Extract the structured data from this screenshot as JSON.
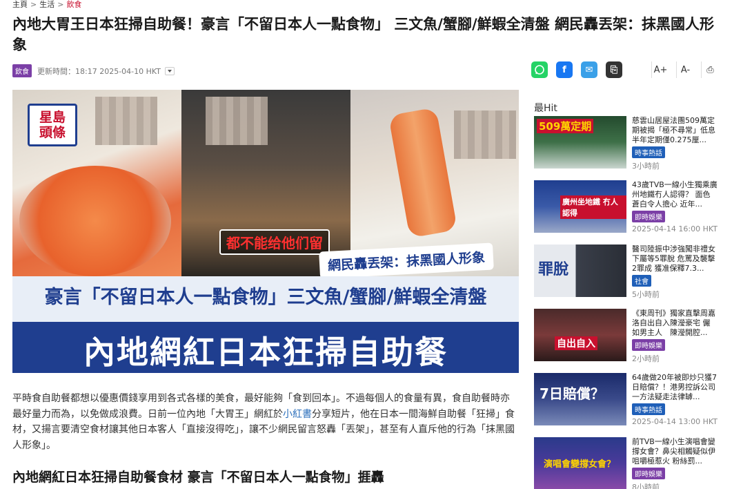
{
  "breadcrumb": {
    "home": "主頁",
    "level1": "生活",
    "current": "飲食"
  },
  "article": {
    "title": "內地大胃王日本狂掃自助餐！豪言「不留日本人一點食物」 三文魚/蟹腳/鮮蝦全清盤 網民轟丟架：抹黑國人形象",
    "category": "飲食",
    "updated": "更新時間：18:17 2025-04-10 HKT",
    "hero": {
      "logo_line1": "星島",
      "logo_line2": "頭條",
      "caption_red": "都不能给他们留",
      "netizen": "網民轟丟架：抹黑國人形象",
      "line1": "豪言「不留日本人一點食物」三文魚/蟹腳/鮮蝦全清盤",
      "line2": "內地網紅日本狂掃自助餐"
    },
    "body_part1": "平時食自助餐都想以優惠價錢享用到各式各樣的美食，最好能夠「食到回本」。不過每個人的食量有異，食自助餐時亦最好量力而為，以免做成浪費。日前一位內地「大胃王」網紅於",
    "body_link": "小紅書",
    "body_part2": "分享短片，他在日本一間海鮮自助餐「狂掃」食材，又揚言要清空食材讓其他日本客人「直接沒得吃」，讓不少網民留言怒轟「丟架」，甚至有人直斥他的行為「抹黑國人形象」。",
    "subhead": "內地網紅日本狂掃自助餐食材 豪言「不留日本人一點食物」捱轟"
  },
  "share": {
    "whatsapp": "WhatsApp",
    "facebook": "f",
    "email": "✉",
    "copy": "⎘"
  },
  "tools": {
    "font_up": "A+",
    "font_down": "A-",
    "print": "⎙"
  },
  "sidebar": {
    "heading": "最Hit",
    "items": [
      {
        "text": "慈雲山居屋法團509萬定期被揭「極不尋常」低息 半年定期僅0.275厘...",
        "badge": "時事熱話",
        "badge_color": "blue",
        "time": "3小時前",
        "thumb_text": "509萬定期"
      },
      {
        "text": "43歲TVB一線小生獨乘廣州地鐵冇人認得？ 面色蒼白令人擔心 近年...",
        "badge": "即時娛樂",
        "badge_color": "purple",
        "time": "2025-04-14 16:00 HKT",
        "thumb_text": "廣州坐地鐵 冇人認得"
      },
      {
        "text": "醫司陸振中涉強闖非禮女下屬等5罪脫 危罵及襲擊2罪成 獲准保釋7.3...",
        "badge": "社會",
        "badge_color": "blue",
        "time": "5小時前",
        "thumb_text": "罪脫"
      },
      {
        "text": "《東周刊》獨家直擊周嘉洛自出自入陳瀅豪宅 儼如男主人　陳瀅開腔...",
        "badge": "即時娛樂",
        "badge_color": "purple",
        "time": "2小時前",
        "thumb_text": "自出自入"
      },
      {
        "text": "64歲做20年被即炒只獲7日賠償？！港男控訴公司一方法疑走法律罅...",
        "badge": "時事熱話",
        "badge_color": "blue",
        "time": "2025-04-14 13:00 HKT",
        "thumb_text": "7日賠償？"
      },
      {
        "text": "前TVB一線小生演唱會變撐女會？鼻尖相觸疑似伊咀嚼極惹火 粉絲罰...",
        "badge": "即時娛樂",
        "badge_color": "purple",
        "time": "8小時前",
        "thumb_text": "演唱會變撐女會？"
      }
    ]
  },
  "colors": {
    "brand_blue": "#1f3e8f",
    "brand_red": "#c8102e",
    "purple": "#7b3fa6"
  }
}
